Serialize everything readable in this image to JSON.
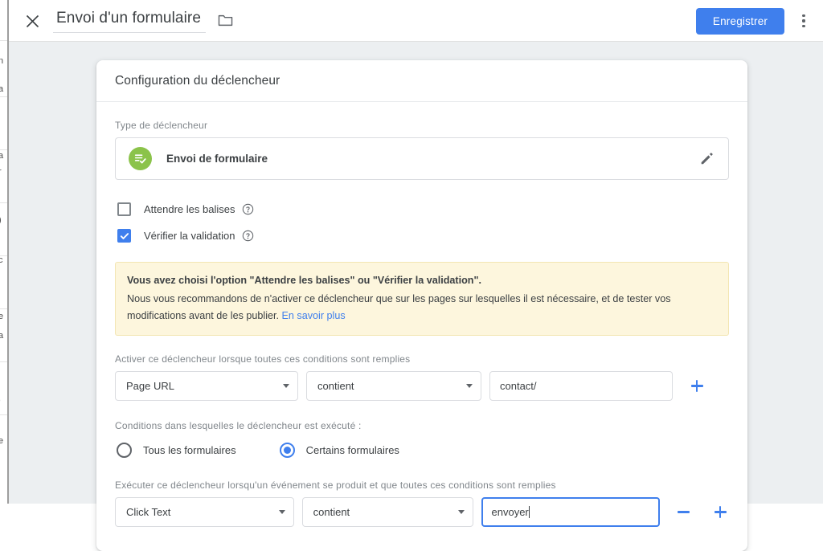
{
  "topbar": {
    "close_icon": "close-icon",
    "title": "Envoi d'un formulaire",
    "folder_icon": "folder-icon",
    "save_label": "Enregistrer",
    "more_icon": "more-vert-icon"
  },
  "card": {
    "title": "Configuration du déclencheur",
    "trigger_type": {
      "label": "Type de déclencheur",
      "icon": "form-submit-icon",
      "icon_color": "#8bc34a",
      "name": "Envoi de formulaire",
      "edit_icon": "pencil-icon"
    },
    "checkboxes": [
      {
        "label": "Attendre les balises",
        "checked": false,
        "help_icon": "help-circle-icon"
      },
      {
        "label": "Vérifier la validation",
        "checked": true,
        "help_icon": "help-circle-icon"
      }
    ],
    "warning": {
      "title": "Vous avez choisi l'option \"Attendre les balises\" ou \"Vérifier la validation\".",
      "body": "Nous vous recommandons de n'activer ce déclencheur que sur les pages sur lesquelles il est nécessaire, et de tester vos modifications avant de les publier.",
      "link_label": "En savoir plus",
      "background": "#fdf6dd",
      "link_color": "#3f7fed"
    },
    "conditions_fire": {
      "label": "Activer ce déclencheur lorsque toutes ces conditions sont remplies",
      "rows": [
        {
          "variable": "Page URL",
          "operator": "contient",
          "value": "contact/",
          "focused": false,
          "has_remove": false,
          "add_label": "+",
          "remove_label": "−"
        }
      ]
    },
    "execution": {
      "label": "Conditions dans lesquelles le déclencheur est exécuté :",
      "options": [
        {
          "label": "Tous les formulaires",
          "selected": false
        },
        {
          "label": "Certains formulaires",
          "selected": true
        }
      ]
    },
    "conditions_event": {
      "label": "Exécuter ce déclencheur lorsqu'un événement se produit et que toutes ces conditions sont remplies",
      "rows": [
        {
          "variable": "Click Text",
          "operator": "contient",
          "value": "envoyer",
          "focused": true,
          "has_remove": true,
          "add_label": "+",
          "remove_label": "−"
        }
      ]
    }
  },
  "background": {
    "fragments": [
      "n",
      "a",
      "a",
      "r",
      ")",
      "c",
      "e",
      "a",
      ",",
      "e"
    ],
    "panel_color": "#eceff1"
  },
  "colors": {
    "accent": "#3f7fed",
    "trigger_green": "#8bc34a",
    "warning_bg": "#fdf6dd",
    "page_bg": "#eceff1"
  }
}
